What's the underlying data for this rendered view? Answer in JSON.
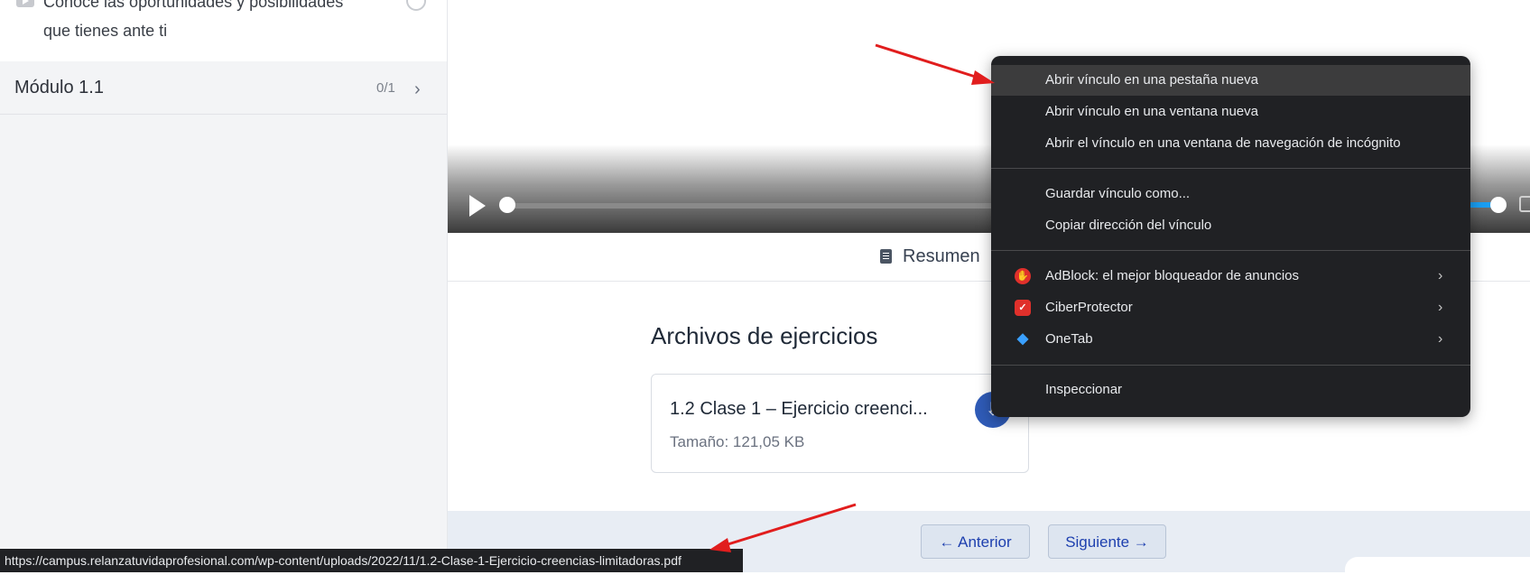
{
  "sidebar": {
    "lesson": {
      "title": "Conoce las oportunidades y posibilidades que tienes ante ti"
    },
    "module": {
      "title": "Módulo 1.1",
      "count": "0/1"
    }
  },
  "tabs": {
    "summary_label": "Resumen"
  },
  "content": {
    "heading": "Archivos de ejercicios",
    "file": {
      "name": "1.2 Clase 1 – Ejercicio creenci...",
      "size": "Tamaño: 121,05 KB"
    }
  },
  "nav": {
    "prev_label": "← Anterior",
    "next_label": "Siguiente →"
  },
  "status_bar": {
    "url": "https://campus.relanzatuvidaprofesional.com/wp-content/uploads/2022/11/1.2-Clase-1-Ejercicio-creencias-limitadoras.pdf"
  },
  "context_menu": {
    "items": [
      {
        "label": "Abrir vínculo en una pestaña nueva"
      },
      {
        "label": "Abrir vínculo en una ventana nueva"
      },
      {
        "label": "Abrir el vínculo en una ventana de navegación de incógnito"
      },
      {
        "label": "Guardar vínculo como..."
      },
      {
        "label": "Copiar dirección del vínculo"
      },
      {
        "label": "AdBlock: el mejor bloqueador de anuncios",
        "icon": "adblock-icon"
      },
      {
        "label": "CiberProtector",
        "icon": "ciberprotector-icon"
      },
      {
        "label": "OneTab",
        "icon": "onetab-icon"
      },
      {
        "label": "Inspeccionar"
      }
    ]
  },
  "colors": {
    "menu_bg": "#202124",
    "accent_blue": "#2f5bb7",
    "annotation_red": "#e11d1d"
  }
}
